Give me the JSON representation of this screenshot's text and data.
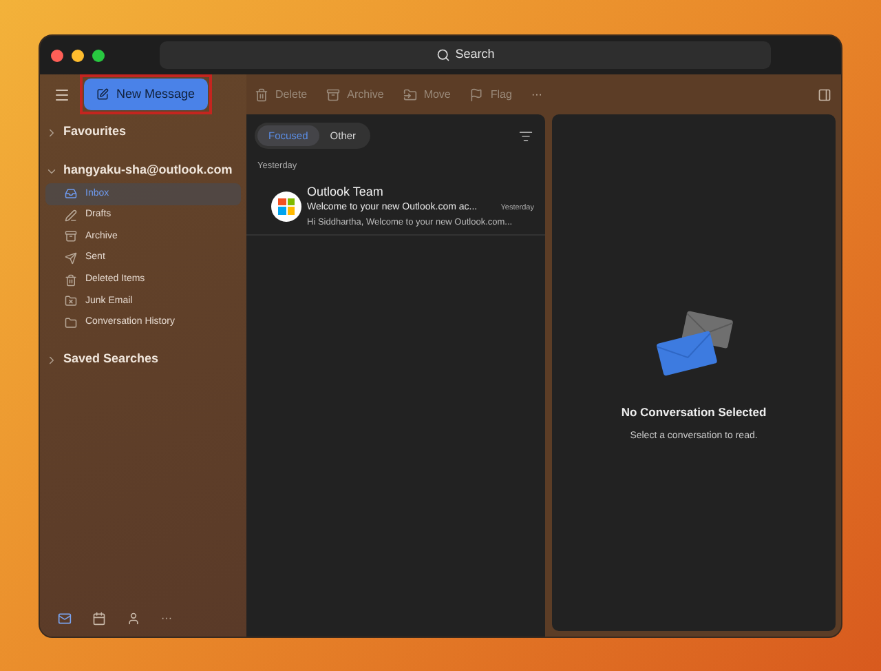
{
  "search": {
    "label": "Search"
  },
  "new_message": {
    "label": "New Message",
    "highlighted": true
  },
  "toolbar": [
    {
      "label": "Delete"
    },
    {
      "label": "Archive"
    },
    {
      "label": "Move"
    },
    {
      "label": "Flag"
    }
  ],
  "toolbar_more": "···",
  "sidebar": {
    "sections": [
      {
        "title": "Favourites",
        "expanded": false
      },
      {
        "title": "hangyaku-sha@outlook.com",
        "expanded": true,
        "children": [
          {
            "label": "Inbox",
            "selected": true
          },
          {
            "label": "Drafts",
            "selected": false
          },
          {
            "label": "Archive",
            "selected": false
          },
          {
            "label": "Sent",
            "selected": false
          },
          {
            "label": "Deleted Items",
            "selected": false
          },
          {
            "label": "Junk Email",
            "selected": false
          },
          {
            "label": "Conversation History",
            "selected": false
          }
        ]
      },
      {
        "title": "Saved Searches",
        "expanded": false
      }
    ],
    "bottom_nav": [
      {
        "selected": true
      },
      {
        "selected": false
      },
      {
        "selected": false
      }
    ],
    "bottom_more": "···"
  },
  "message_list": {
    "tabs": [
      {
        "label": "Focused",
        "selected": true
      },
      {
        "label": "Other",
        "selected": false
      }
    ],
    "group": "Yesterday",
    "messages": [
      {
        "sender": "Outlook Team",
        "subject": "Welcome to your new Outlook.com ac...",
        "time": "Yesterday",
        "preview": "Hi Siddhartha, Welcome to your new Outlook.com..."
      }
    ]
  },
  "reading_pane": {
    "title": "No Conversation Selected",
    "subtitle": "Select a conversation to read."
  }
}
